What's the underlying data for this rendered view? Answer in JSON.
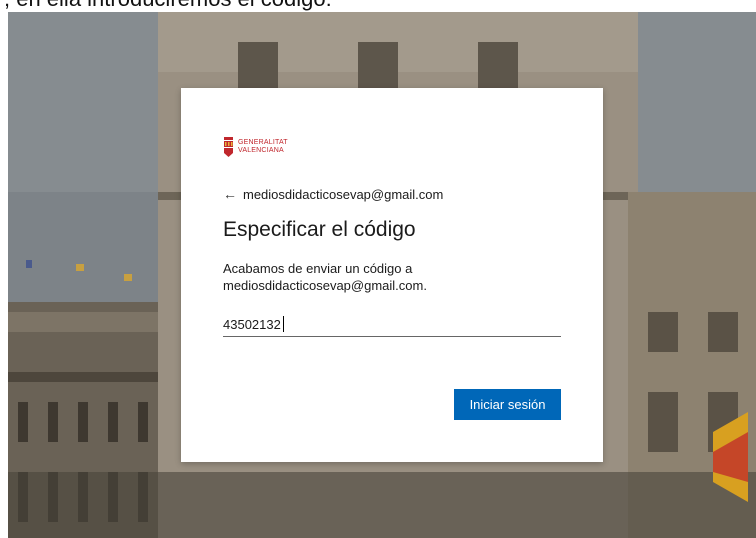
{
  "document_text": "; en ella introduciremos el código:",
  "logo": {
    "line1": "GENERALITAT",
    "line2": "VALENCIANA",
    "accent": "#c0272d"
  },
  "back": {
    "icon": "arrow-left-icon",
    "arrow": "←",
    "email": "mediosdidacticosevap@gmail.com"
  },
  "title": "Especificar el código",
  "description": {
    "line1": "Acabamos de enviar un código a",
    "line2": "mediosdidacticosevap@gmail.com."
  },
  "code_input": {
    "value": "43502132",
    "placeholder": ""
  },
  "signin_button": {
    "label": "Iniciar sesión",
    "color": "#0067b8"
  }
}
